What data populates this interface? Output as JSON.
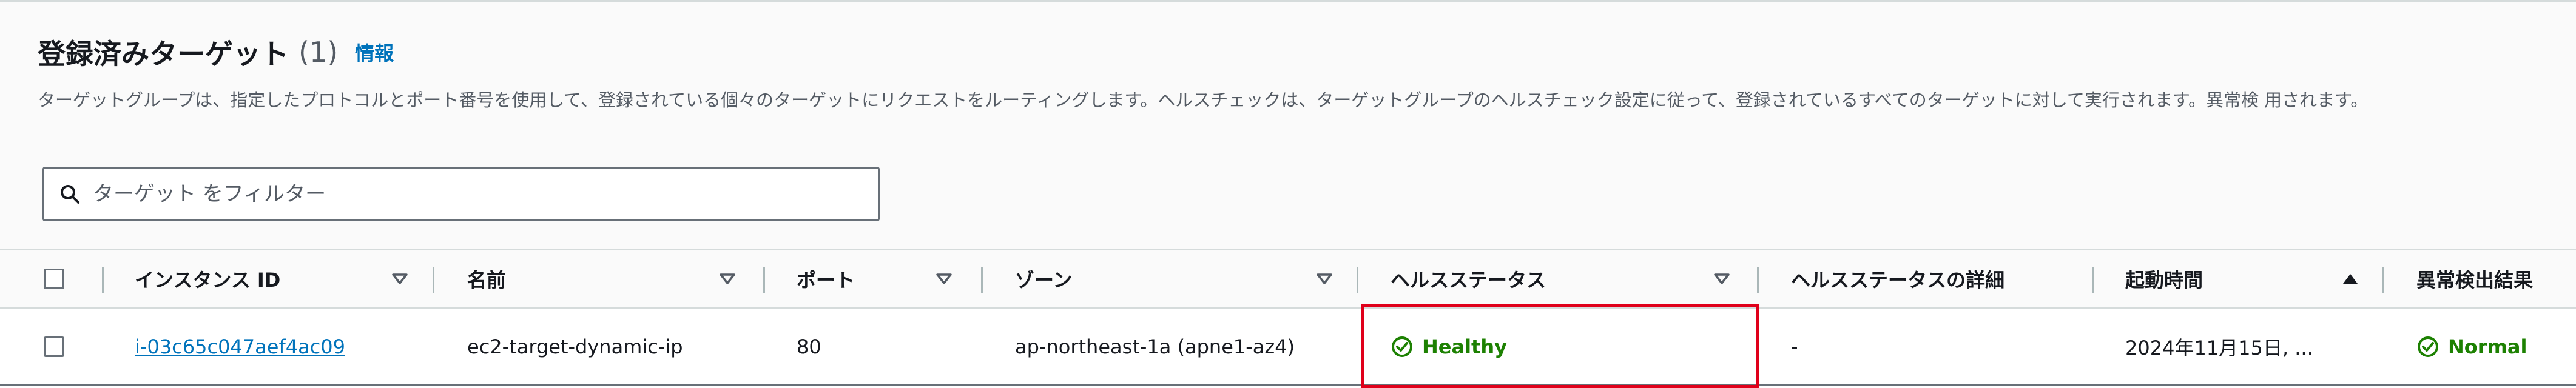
{
  "section": {
    "title": "登録済みターゲット",
    "count": "(1)",
    "info_link": "情報",
    "description": "ターゲットグループは、指定したプロトコルとポート番号を使用して、登録されている個々のターゲットにリクエストをルーティングします。ヘルスチェックは、ターゲットグループのヘルスチェック設定に従って、登録されているすべてのターゲットに対して実行されます。異常検 用されます。"
  },
  "filter": {
    "placeholder": "ターゲット をフィルター",
    "value": ""
  },
  "table": {
    "columns": [
      {
        "label": "インスタンス ID",
        "sortable": true,
        "sort_state": "none"
      },
      {
        "label": "名前",
        "sortable": true,
        "sort_state": "none"
      },
      {
        "label": "ポート",
        "sortable": true,
        "sort_state": "none"
      },
      {
        "label": "ゾーン",
        "sortable": true,
        "sort_state": "none"
      },
      {
        "label": "ヘルスステータス",
        "sortable": true,
        "sort_state": "none"
      },
      {
        "label": "ヘルスステータスの詳細",
        "sortable": false
      },
      {
        "label": "起動時間",
        "sortable": true,
        "sort_state": "ascending"
      },
      {
        "label": "異常検出結果",
        "sortable": false
      }
    ],
    "rows": [
      {
        "instance_id": "i-03c65c047aef4ac09",
        "name": "ec2-target-dynamic-ip",
        "port": "80",
        "zone": "ap-northeast-1a (apne1-az4)",
        "health_status": "Healthy",
        "health_status_details": "-",
        "launch_time": "2024年11月15日, ...",
        "anomaly_result": "Normal"
      }
    ]
  },
  "icons": {
    "search": "search-icon",
    "sort_desc": "caret-down-icon",
    "sort_asc": "caret-up-icon",
    "status_ok": "check-circle-icon"
  },
  "colors": {
    "link": "#0073bb",
    "success": "#1d8102",
    "highlight": "#e0001a",
    "text": "#16191f",
    "secondary_text": "#545b64"
  }
}
